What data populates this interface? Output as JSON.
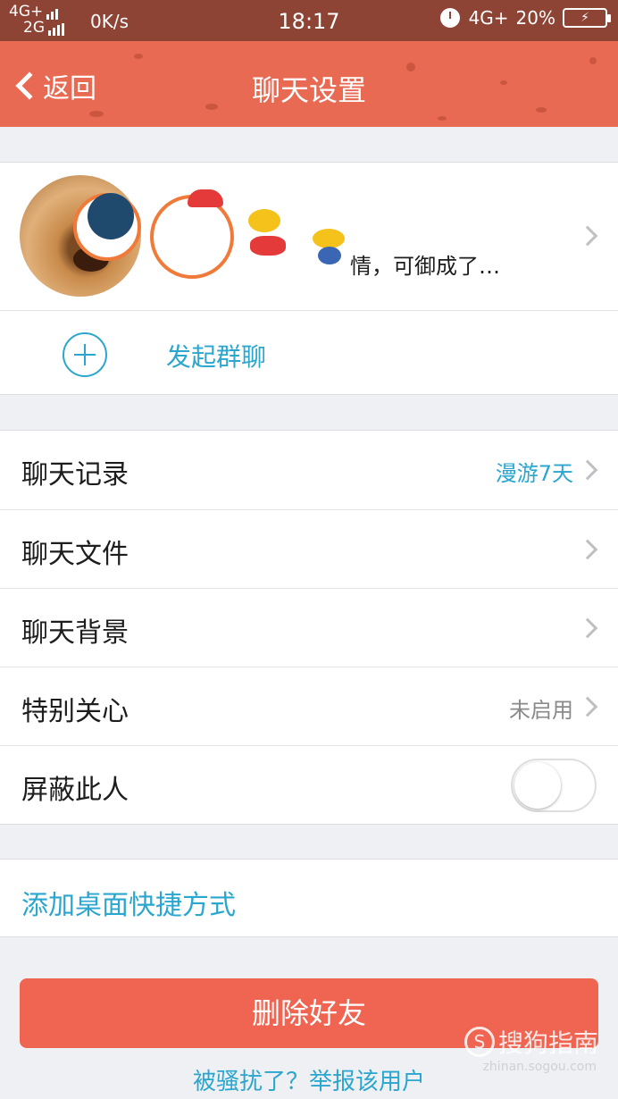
{
  "status_bar": {
    "net1": "4G+",
    "net2": "2G",
    "speed": "0K/s",
    "time": "18:17",
    "net_right": "4G+",
    "battery": "20%"
  },
  "header": {
    "back_label": "返回",
    "title": "聊天设置"
  },
  "profile": {
    "signature": "情，可御成了…"
  },
  "group_chat": {
    "label": "发起群聊"
  },
  "settings": [
    {
      "label": "聊天记录",
      "value": "漫游7天",
      "value_color": "#2aa6cf"
    },
    {
      "label": "聊天文件",
      "value": ""
    },
    {
      "label": "聊天背景",
      "value": ""
    },
    {
      "label": "特别关心",
      "value": "未启用"
    },
    {
      "label": "屏蔽此人",
      "toggle_on": false
    }
  ],
  "shortcut": {
    "label": "添加桌面快捷方式"
  },
  "actions": {
    "delete_label": "删除好友",
    "report_label": "被骚扰了？举报该用户"
  },
  "watermark": {
    "text": "搜狗指南",
    "url": "zhinan.sogou.com"
  },
  "colors": {
    "header_bg": "#e96a53",
    "accent": "#2aa6cf",
    "delete_bg": "#f06552"
  }
}
